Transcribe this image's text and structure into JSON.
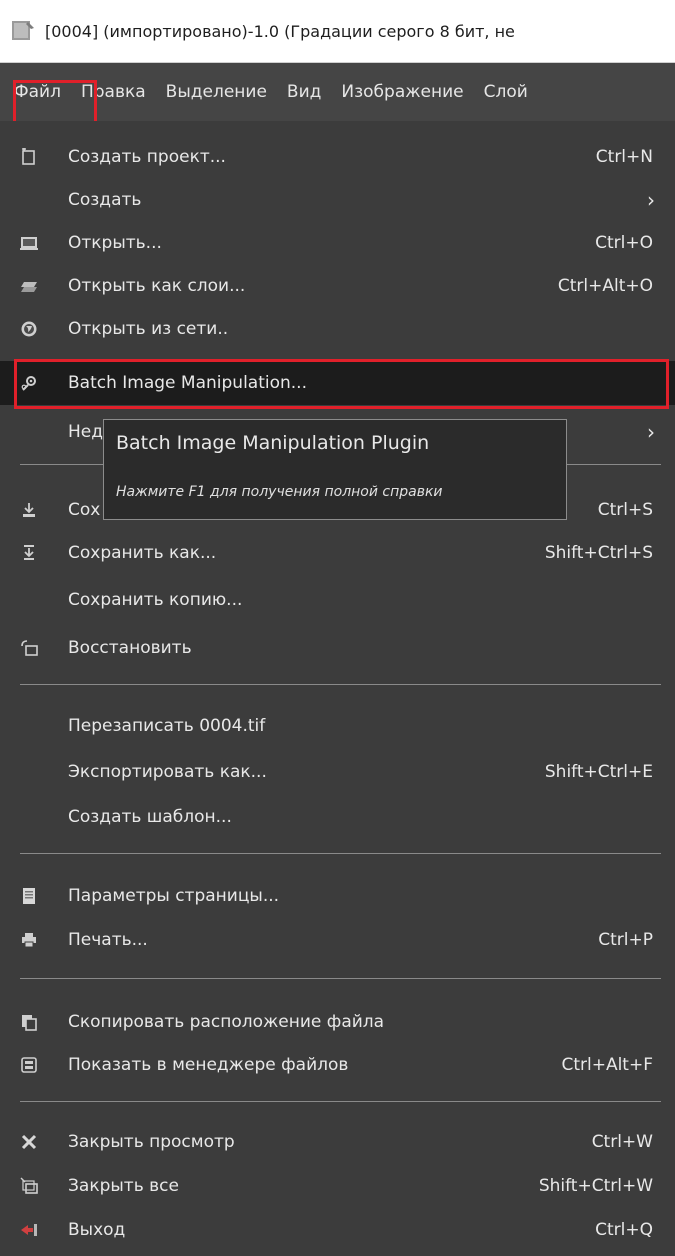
{
  "window": {
    "title": "[0004] (импортировано)-1.0 (Градации серого 8 бит, не"
  },
  "menubar": {
    "items": [
      "Файл",
      "Правка",
      "Выделение",
      "Вид",
      "Изображение",
      "Слой"
    ]
  },
  "file_menu": {
    "new_project": {
      "label": "Создать проект...",
      "shortcut": "Ctrl+N",
      "icon": "new-file-icon"
    },
    "create": {
      "label": "Создать"
    },
    "open": {
      "label": "Открыть...",
      "shortcut": "Ctrl+O",
      "icon": "open-icon"
    },
    "open_as_layers": {
      "label": "Открыть как слои...",
      "shortcut": "Ctrl+Alt+O",
      "icon": "layers-icon"
    },
    "open_location": {
      "label": "Открыть из сети..",
      "icon": "globe-icon"
    },
    "batch": {
      "label": "Batch Image Manipulation...",
      "icon": "plugin-icon"
    },
    "recent": {
      "label": "Нед"
    },
    "save": {
      "label": "Сох",
      "shortcut": "Ctrl+S",
      "icon": "save-icon"
    },
    "save_as": {
      "label": "Сохранить как...",
      "shortcut": "Shift+Ctrl+S",
      "icon": "save-as-icon"
    },
    "save_copy": {
      "label": "Сохранить копию..."
    },
    "revert": {
      "label": "Восстановить",
      "icon": "revert-icon"
    },
    "overwrite": {
      "label": "Перезаписать 0004.tif"
    },
    "export_as": {
      "label": "Экспортировать как...",
      "shortcut": "Shift+Ctrl+E"
    },
    "create_template": {
      "label": "Создать шаблон..."
    },
    "page_setup": {
      "label": "Параметры страницы...",
      "icon": "page-setup-icon"
    },
    "print": {
      "label": "Печать...",
      "shortcut": "Ctrl+P",
      "icon": "printer-icon"
    },
    "copy_location": {
      "label": "Скопировать расположение файла",
      "icon": "copy-icon"
    },
    "show_in_manager": {
      "label": "Показать в менеджере файлов",
      "shortcut": "Ctrl+Alt+F",
      "icon": "file-manager-icon"
    },
    "close_view": {
      "label": "Закрыть просмотр",
      "shortcut": "Ctrl+W",
      "icon": "close-icon"
    },
    "close_all": {
      "label": "Закрыть все",
      "shortcut": "Shift+Ctrl+W",
      "icon": "close-all-icon"
    },
    "quit": {
      "label": "Выход",
      "shortcut": "Ctrl+Q",
      "icon": "quit-icon"
    }
  },
  "tooltip": {
    "title": "Batch Image Manipulation Plugin",
    "hint": "Нажмите F1 для получения полной справки"
  },
  "colors": {
    "highlight_box": "#e0202a",
    "menu_bg": "#3c3c3c",
    "selected_row_bg": "#1c1c1c"
  }
}
